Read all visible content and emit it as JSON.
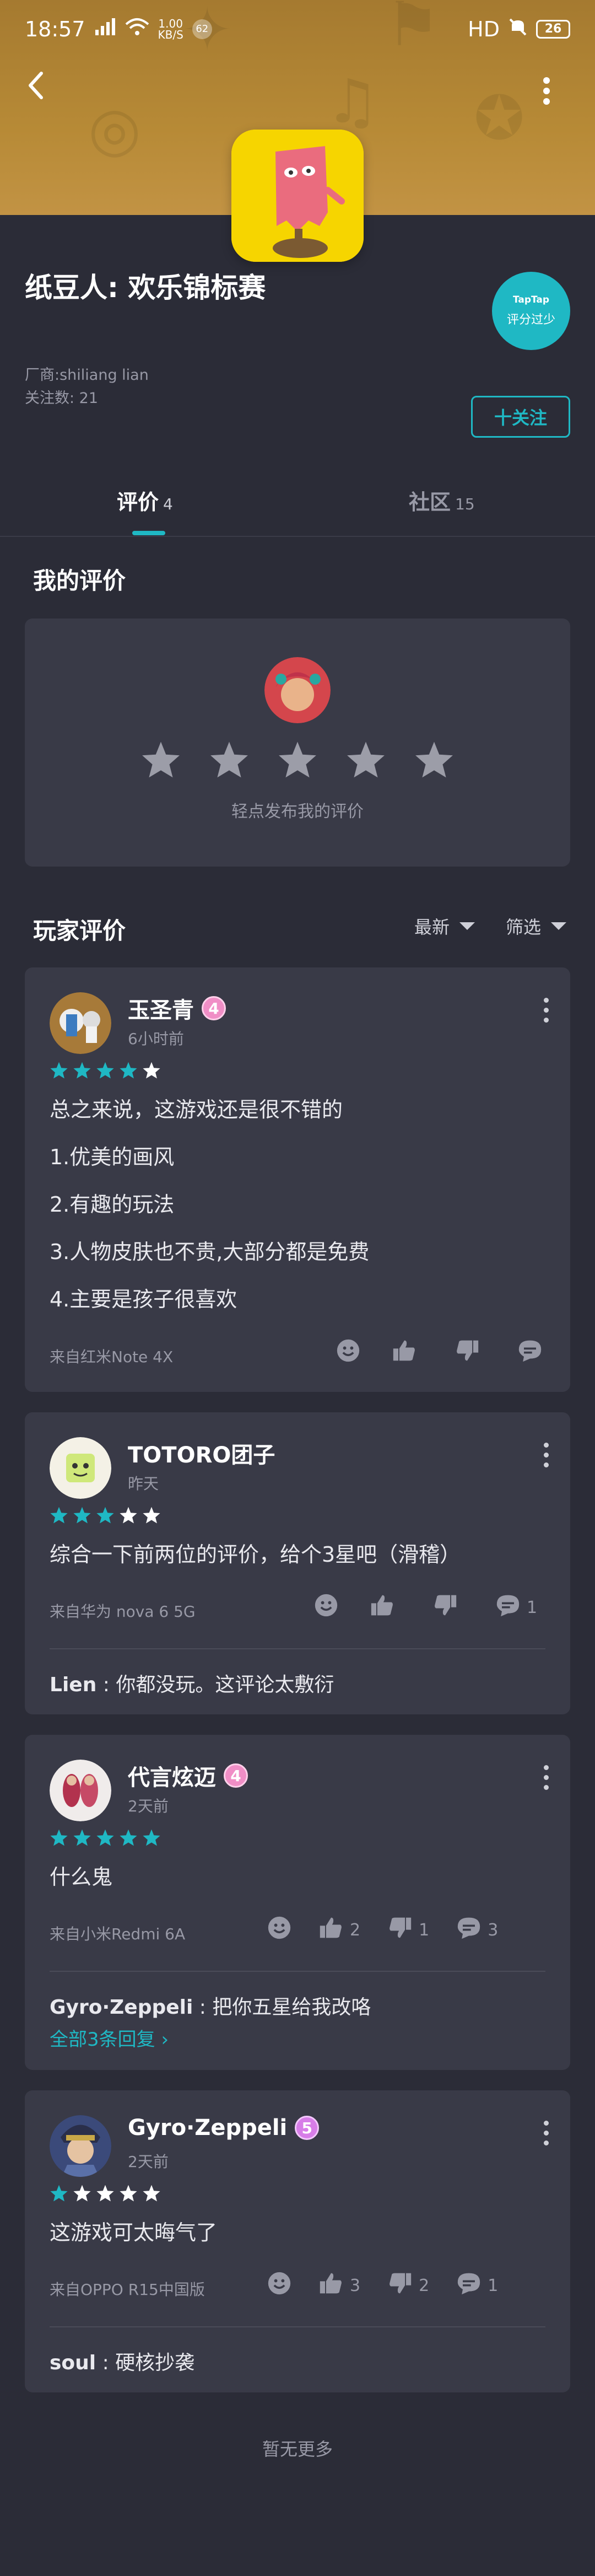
{
  "status_bar": {
    "time": "18:57",
    "speed_value": "1.00",
    "speed_unit": "KB/S",
    "notif_count": "62",
    "hd_label": "HD",
    "battery": "26"
  },
  "app": {
    "title": "纸豆人: 欢乐锦标赛",
    "vendor": "厂商:shiliang lian",
    "followers": "关注数: 21",
    "follow_label": "十关注",
    "rating_badge_brand": "TapTap",
    "rating_badge_text": "评分过少"
  },
  "tabs": [
    {
      "label": "评价",
      "count": "4"
    },
    {
      "label": "社区",
      "count": "15"
    }
  ],
  "my_review": {
    "title": "我的评价",
    "prompt": "轻点发布我的评价"
  },
  "player_reviews": {
    "title": "玩家评价",
    "sort_label": "最新",
    "filter_label": "筛选"
  },
  "reviews": [
    {
      "name": "玉圣青",
      "level": "4",
      "time": "6小时前",
      "rating": 4,
      "lines": [
        "总之来说，这游戏还是很不错的",
        "1.优美的画风",
        "2.有趣的玩法",
        "3.人物皮肤也不贵,大部分都是免费",
        "4.主要是孩子很喜欢"
      ],
      "device": "来自红米Note 4X",
      "likes": "",
      "dislikes": "",
      "comments": ""
    },
    {
      "name": "TOTORO团子",
      "level": "",
      "time": "昨天",
      "rating": 3,
      "lines": [
        "综合一下前两位的评价，给个3星吧（滑稽）"
      ],
      "device": "来自华为 nova 6 5G",
      "likes": "",
      "dislikes": "",
      "comments": "1",
      "reply_user": "Lien",
      "reply_text": " : 你都没玩。这评论太敷衍"
    },
    {
      "name": "代言炫迈",
      "level": "4",
      "time": "2天前",
      "rating": 5,
      "lines": [
        "什么鬼"
      ],
      "device": "来自小米Redmi 6A",
      "likes": "2",
      "dislikes": "1",
      "comments": "3",
      "reply_user": "Gyro·Zeppeli",
      "reply_text": " : 把你五星给我改咯",
      "all_replies": "全部3条回复 ›"
    },
    {
      "name": "Gyro·Zeppeli",
      "level": "5",
      "time": "2天前",
      "rating": 1,
      "lines": [
        "这游戏可太晦气了"
      ],
      "device": "来自OPPO R15中国版",
      "likes": "3",
      "dislikes": "2",
      "comments": "1",
      "reply_user": "soul",
      "reply_text": " : 硬核抄袭"
    }
  ],
  "no_more": "暂无更多",
  "colors": {
    "accent": "#1fb8c4",
    "header": "#b78a36",
    "background": "#2b2c37",
    "card": "#393a47"
  }
}
